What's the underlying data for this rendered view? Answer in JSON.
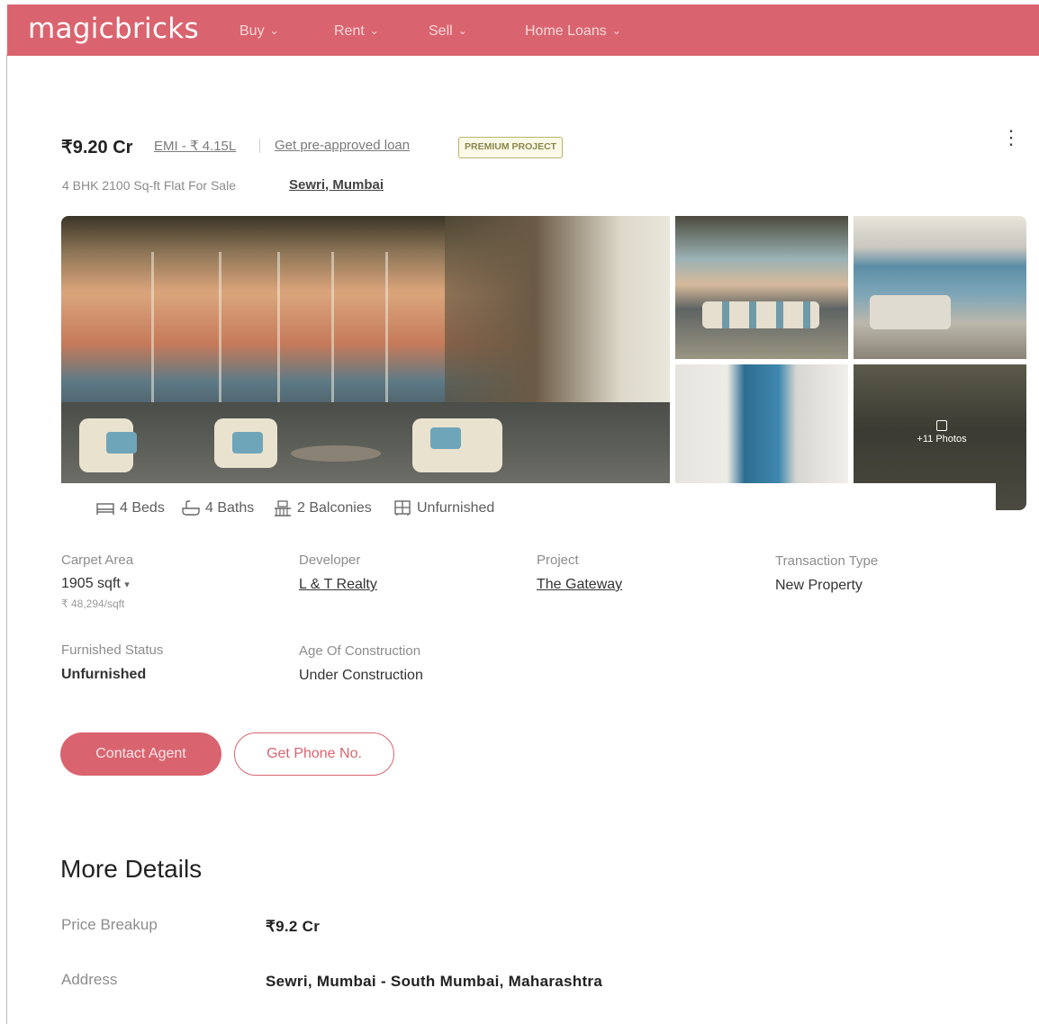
{
  "header": {
    "logo": "magicbricks",
    "nav": [
      {
        "label": "Buy"
      },
      {
        "label": "Rent"
      },
      {
        "label": "Sell"
      },
      {
        "label": "Home Loans"
      }
    ]
  },
  "listing": {
    "price": "₹9.20 Cr",
    "emi": "EMI - ₹ 4.15L",
    "preapproved": "Get pre-approved loan",
    "badge": "PREMIUM PROJECT",
    "more_icon": "⋮",
    "subtitle": "4 BHK 2100 Sq-ft Flat For Sale",
    "locality": "Sewri, Mumbai",
    "photos_label": "+11 Photos"
  },
  "features": [
    {
      "icon": "bed-icon",
      "label": "4 Beds"
    },
    {
      "icon": "bath-icon",
      "label": "4 Baths"
    },
    {
      "icon": "balcony-icon",
      "label": "2 Balconies"
    },
    {
      "icon": "furnishing-icon",
      "label": "Unfurnished"
    }
  ],
  "details": {
    "carpet_area": {
      "label": "Carpet Area",
      "value": "1905 sqft",
      "sub": "₹ 48,294/sqft"
    },
    "developer": {
      "label": "Developer",
      "value": "L & T Realty"
    },
    "project": {
      "label": "Project",
      "value": "The Gateway"
    },
    "transaction": {
      "label": "Transaction Type",
      "value": "New Property"
    },
    "furnished": {
      "label": "Furnished Status",
      "value": "Unfurnished"
    },
    "age": {
      "label": "Age Of Construction",
      "value": "Under Construction"
    }
  },
  "actions": {
    "contact": "Contact Agent",
    "phone": "Get Phone No."
  },
  "more_details": {
    "title": "More Details",
    "rows": [
      {
        "label": "Price Breakup",
        "value": "₹9.2 Cr"
      },
      {
        "label": "Address",
        "value": "Sewri, Mumbai - South Mumbai, Maharashtra"
      }
    ]
  },
  "colors": {
    "brand": "#d9646f",
    "badge_border": "#b9b36b"
  }
}
